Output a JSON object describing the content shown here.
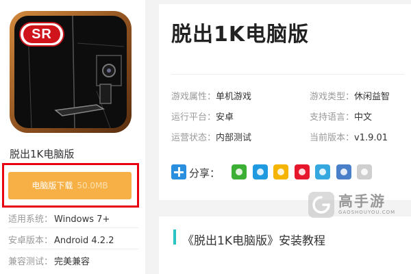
{
  "app": {
    "badge": "SR",
    "name": "脱出1K电脑版",
    "title": "脱出1K电脑版"
  },
  "download": {
    "label": "电脑版下载",
    "size": "50.0MB"
  },
  "specs": [
    {
      "label": "适用系统：",
      "value": "Windows 7+"
    },
    {
      "label": "安卓版本：",
      "value": "Android 4.2.2"
    },
    {
      "label": "兼容测试：",
      "value": "完美兼容"
    }
  ],
  "attributes": [
    {
      "label": "游戏属性：",
      "value": "单机游戏"
    },
    {
      "label": "游戏类型：",
      "value": "休闲益智"
    },
    {
      "label": "运行平台：",
      "value": "安卓"
    },
    {
      "label": "支持语言：",
      "value": "中文"
    },
    {
      "label": "运营状态：",
      "value": "内部测试"
    },
    {
      "label": "当前版本：",
      "value": "v1.9.01"
    }
  ],
  "share": {
    "label": "分享：",
    "icons": [
      "wechat-icon",
      "qq-icon",
      "qzone-icon",
      "weibo-icon",
      "tencent-weibo-icon",
      "print-icon",
      "copy-icon"
    ],
    "colors": [
      "#3cb034",
      "#1f9ae0",
      "#f5b400",
      "#e6162d",
      "#36a8e0",
      "#4a7fc9",
      "#cfcfcf"
    ]
  },
  "tutorial": {
    "title": "《脱出1K电脑版》安装教程"
  },
  "watermark": {
    "name": "高手游",
    "domain": "GAOSHOUYOU.COM"
  }
}
